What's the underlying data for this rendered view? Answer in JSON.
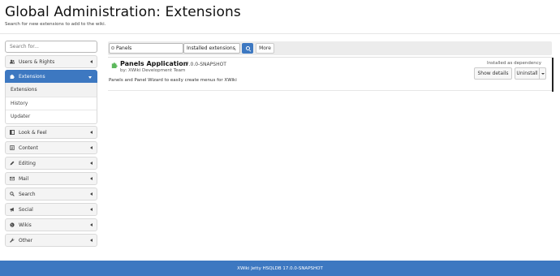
{
  "header": {
    "title": "Global Administration: Extensions",
    "hint": "Search for new extensions to add to the wiki."
  },
  "sidebar": {
    "search_placeholder": "Search for...",
    "categories": [
      {
        "label": "Users & Rights",
        "icon": "users-icon"
      },
      {
        "label": "Extensions",
        "icon": "puzzle-icon",
        "active": true
      },
      {
        "label": "Look & Feel",
        "icon": "layout-icon"
      },
      {
        "label": "Content",
        "icon": "document-icon"
      },
      {
        "label": "Editing",
        "icon": "pencil-icon"
      },
      {
        "label": "Mail",
        "icon": "envelope-icon"
      },
      {
        "label": "Search",
        "icon": "search-icon"
      },
      {
        "label": "Social",
        "icon": "bullhorn-icon"
      },
      {
        "label": "Wikis",
        "icon": "globe-icon"
      },
      {
        "label": "Other",
        "icon": "wrench-icon"
      }
    ],
    "submenu": [
      "Extensions",
      "History",
      "Updater"
    ]
  },
  "toolbar": {
    "search_value": "Panels",
    "filter_selected": "Installed extensions",
    "more_label": "More"
  },
  "extension": {
    "name": "Panels Application",
    "version": "17.0.0-SNAPSHOT",
    "author": "by: XWiki Development Team",
    "description": "Panels and Panel Wizard to easily create menus for XWiki",
    "status": "Installed as dependency",
    "details_label": "Show details",
    "uninstall_label": "Uninstall"
  },
  "footer": {
    "text": "XWiki Jetty HSQLDB 17.0.0-SNAPSHOT"
  },
  "colors": {
    "accent": "#3d78c1",
    "puzzle": "#5cb85c"
  }
}
